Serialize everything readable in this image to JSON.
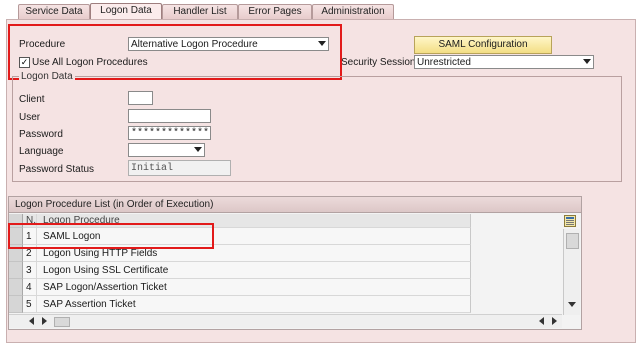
{
  "tabs": [
    "Service Data",
    "Logon Data",
    "Handler List",
    "Error Pages",
    "Administration"
  ],
  "active_tab": "Logon Data",
  "procedure": {
    "label": "Procedure",
    "value": "Alternative Logon Procedure"
  },
  "use_all": {
    "label": "Use All Logon Procedures",
    "checked": true
  },
  "saml_button": "SAML Configuration",
  "security_session": {
    "label": "Security Session:",
    "value": "Unrestricted"
  },
  "logon_data": {
    "title": "Logon Data",
    "client_label": "Client",
    "client_value": "",
    "user_label": "User",
    "user_value": "",
    "password_label": "Password",
    "password_value": "*************",
    "language_label": "Language",
    "language_value": "",
    "status_label": "Password Status",
    "status_value": "Initial"
  },
  "procedure_list": {
    "title": "Logon Procedure List (in Order of Execution)",
    "col_num": "N..",
    "col_name": "Logon Procedure",
    "rows": [
      {
        "n": "1",
        "name": "SAML Logon"
      },
      {
        "n": "2",
        "name": "Logon Using HTTP Fields"
      },
      {
        "n": "3",
        "name": "Logon Using SSL Certificate"
      },
      {
        "n": "4",
        "name": "SAP Logon/Assertion Ticket"
      },
      {
        "n": "5",
        "name": "SAP Assertion Ticket"
      }
    ]
  },
  "icons": [
    "dropdown-arrow-icon",
    "checkmark-icon",
    "table-settings-icon",
    "scroll-up-icon",
    "scroll-down-icon",
    "scroll-left-icon",
    "scroll-right-icon"
  ],
  "colors": {
    "panel": "#f5e3e3",
    "highlight": "#e21a1a",
    "button": "#f3de85"
  }
}
